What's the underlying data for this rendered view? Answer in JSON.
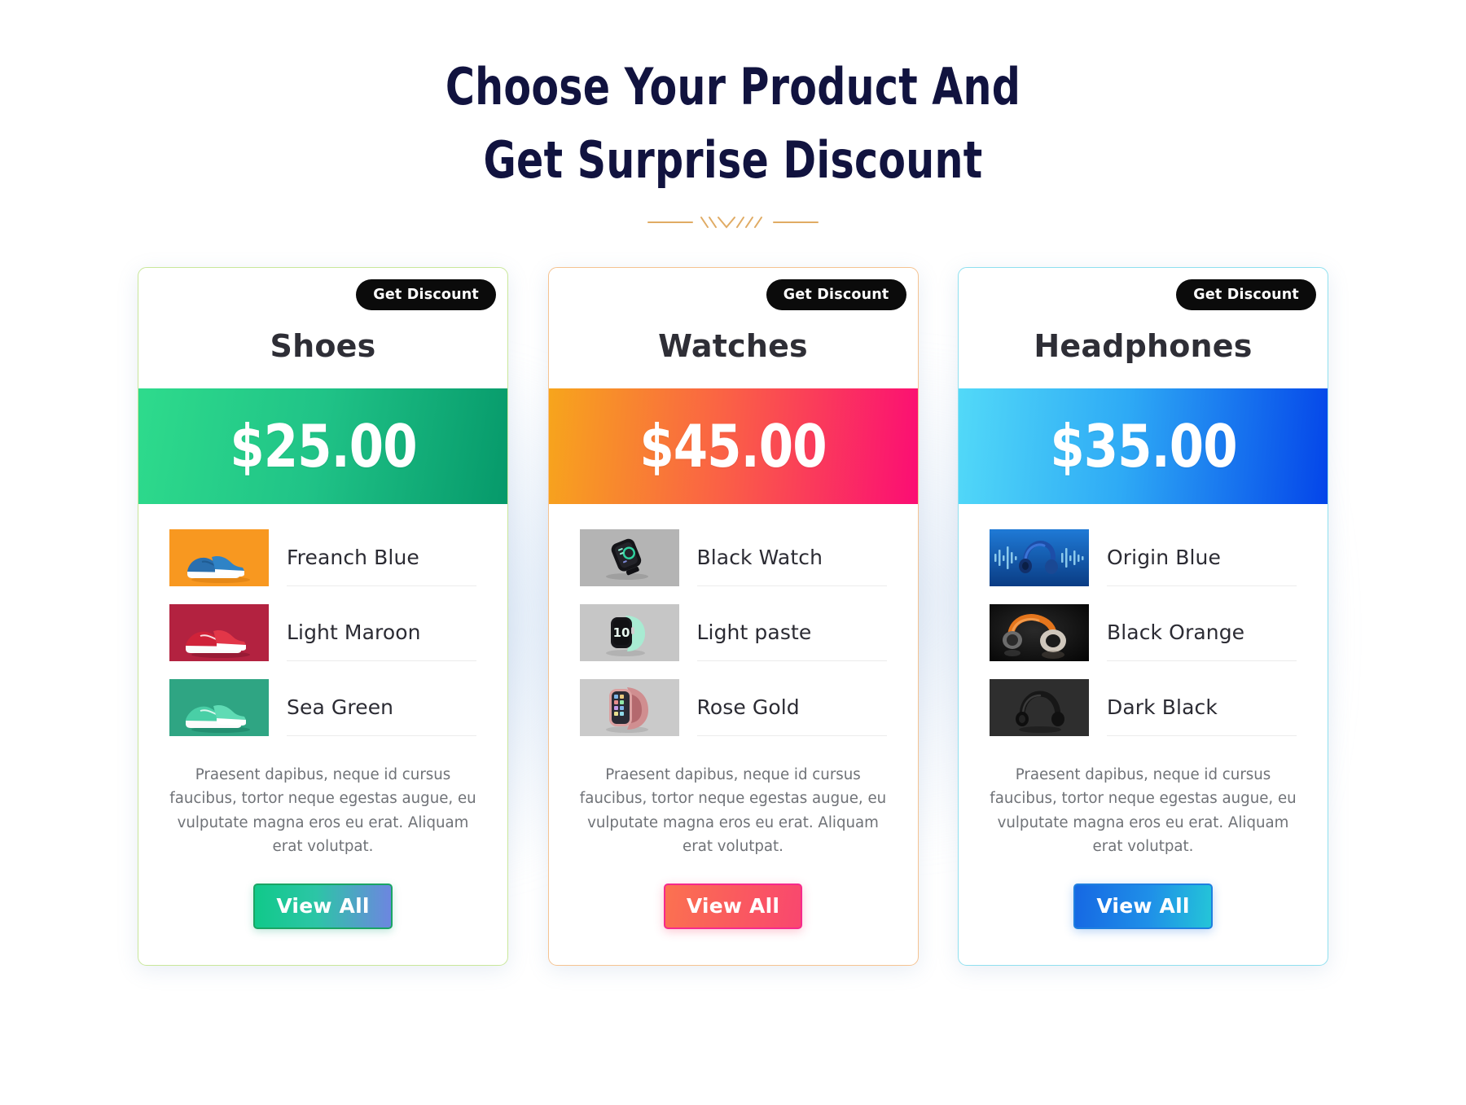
{
  "heading": {
    "line1": "Choose Your Product And",
    "line2": "Get Surprise Discount",
    "color": "#11133f",
    "divider_color": "#e0ab64",
    "divider_icon": "zigzag-chevron-ornament"
  },
  "common": {
    "badge_label": "Get Discount",
    "cta_label": "View All",
    "description": "Praesent dapibus, neque id cursus faucibus, tortor neque egestas augue, eu vulputate magna eros eu erat. Aliquam erat volutpat."
  },
  "cards": [
    {
      "title": "Shoes",
      "price": "$25.00",
      "badge_label": "Get Discount",
      "cta_label": "View All",
      "border_color": "#c9e79a",
      "band_from": "#2edb8c",
      "band_to": "#06996a",
      "cta_from": "#11c98a",
      "cta_to": "#6d86e0",
      "description": "Praesent dapibus, neque id cursus faucibus, tortor neque egestas augue, eu vulputate magna eros eu erat. Aliquam erat volutpat.",
      "products": [
        {
          "name": "Freanch Blue",
          "thumb_icon": "sneaker-thumb-blue-on-orange",
          "bg": "#f89820",
          "shoe": "#1f7fc2"
        },
        {
          "name": "Light Maroon",
          "thumb_icon": "sneaker-thumb-red-on-crimson",
          "bg": "#b32240",
          "shoe": "#e0293f"
        },
        {
          "name": "Sea Green",
          "thumb_icon": "sneaker-thumb-teal-on-green",
          "bg": "#2fa583",
          "shoe": "#49cfa6"
        }
      ]
    },
    {
      "title": "Watches",
      "price": "$45.00",
      "badge_label": "Get Discount",
      "cta_label": "View All",
      "border_color": "#f5c391",
      "band_from": "#f7a51c",
      "band_to": "#fb0d74",
      "cta_from": "#fb7250",
      "cta_to": "#f9476f",
      "description": "Praesent dapibus, neque id cursus faucibus, tortor neque egestas augue, eu vulputate magna eros eu erat. Aliquam erat volutpat.",
      "products": [
        {
          "name": "Black Watch",
          "thumb_icon": "smartwatch-thumb-black-on-gray",
          "bg": "#b4b4b4",
          "body": "#131316"
        },
        {
          "name": "Light paste",
          "thumb_icon": "smartwatch-thumb-mint-on-gray",
          "bg": "#c6c6c6",
          "body": "#a8ebd2"
        },
        {
          "name": "Rose Gold",
          "thumb_icon": "smartwatch-thumb-rosegold-on-gray",
          "bg": "#cacaca",
          "body": "#d99ea0"
        }
      ]
    },
    {
      "title": "Headphones",
      "price": "$35.00",
      "badge_label": "Get Discount",
      "cta_label": "View All",
      "border_color": "#8fe0ef",
      "band_from": "#52d9f8",
      "band_to": "#0445e9",
      "cta_from": "#1668e3",
      "cta_to": "#24c5d8",
      "description": "Praesent dapibus, neque id cursus faucibus, tortor neque egestas augue, eu vulputate magna eros eu erat. Aliquam erat volutpat.",
      "products": [
        {
          "name": "Origin Blue",
          "thumb_icon": "headphones-thumb-blue-waveform",
          "bg": "#1160b8",
          "body": "#123f8c"
        },
        {
          "name": "Black Orange",
          "thumb_icon": "headphones-thumb-black-orange",
          "bg": "#0c0c0c",
          "body": "#e4751c"
        },
        {
          "name": "Dark Black",
          "thumb_icon": "headphones-thumb-dark-black",
          "bg": "#2e2e2e",
          "body": "#141414"
        }
      ]
    }
  ]
}
